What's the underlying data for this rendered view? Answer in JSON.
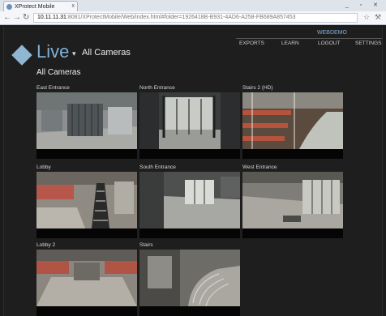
{
  "browser": {
    "tab_title": "XProtect Mobile",
    "tab_close": "x",
    "url_host": "10.11.11.31",
    "url_rest": ":8081/XProtectMobile/Web/index.html#folder=1926418B-B931-4AD6-A258-FB689A857453"
  },
  "app": {
    "title": "Live",
    "caret": "▾",
    "view_title": "All Cameras",
    "user": "WEBDEMO",
    "nav": {
      "exports": "EXPORTS",
      "learn": "LEARN",
      "logout": "LOGOUT",
      "settings": "SETTINGS"
    },
    "section_title": "All Cameras"
  },
  "cameras": [
    {
      "label": "East Entrance"
    },
    {
      "label": "North Entrance"
    },
    {
      "label": "Stairs 2 (HD)"
    },
    {
      "label": "Lobby"
    },
    {
      "label": "South Entrance"
    },
    {
      "label": "West Entrance"
    },
    {
      "label": "Lobby 2"
    },
    {
      "label": "Stairs"
    }
  ],
  "colors": {
    "accent": "#7fb0d6",
    "background": "#1e1e1e"
  }
}
